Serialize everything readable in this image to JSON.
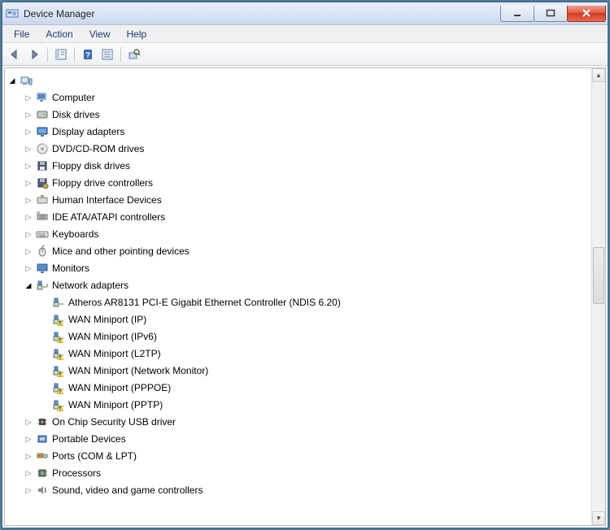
{
  "window": {
    "title": "Device Manager"
  },
  "menu": {
    "file": "File",
    "action": "Action",
    "view": "View",
    "help": "Help"
  },
  "root": {
    "label": ""
  },
  "categories": [
    {
      "label": "Computer",
      "icon": "computer"
    },
    {
      "label": "Disk drives",
      "icon": "disk"
    },
    {
      "label": "Display adapters",
      "icon": "display"
    },
    {
      "label": "DVD/CD-ROM drives",
      "icon": "optical"
    },
    {
      "label": "Floppy disk drives",
      "icon": "floppy"
    },
    {
      "label": "Floppy drive controllers",
      "icon": "floppy-ctrl"
    },
    {
      "label": "Human Interface Devices",
      "icon": "hid"
    },
    {
      "label": "IDE ATA/ATAPI controllers",
      "icon": "ide"
    },
    {
      "label": "Keyboards",
      "icon": "keyboard"
    },
    {
      "label": "Mice and other pointing devices",
      "icon": "mouse"
    },
    {
      "label": "Monitors",
      "icon": "monitor"
    }
  ],
  "network": {
    "label": "Network adapters",
    "children": [
      {
        "label": "Atheros AR8131 PCI-E Gigabit Ethernet Controller (NDIS 6.20)",
        "warn": false
      },
      {
        "label": "WAN Miniport (IP)",
        "warn": true
      },
      {
        "label": "WAN Miniport (IPv6)",
        "warn": true
      },
      {
        "label": "WAN Miniport (L2TP)",
        "warn": true
      },
      {
        "label": "WAN Miniport (Network Monitor)",
        "warn": true
      },
      {
        "label": "WAN Miniport (PPPOE)",
        "warn": true
      },
      {
        "label": "WAN Miniport (PPTP)",
        "warn": true
      }
    ]
  },
  "categories2": [
    {
      "label": "On Chip Security USB driver",
      "icon": "chip"
    },
    {
      "label": "Portable Devices",
      "icon": "portable"
    },
    {
      "label": "Ports (COM & LPT)",
      "icon": "ports"
    },
    {
      "label": "Processors",
      "icon": "cpu"
    },
    {
      "label": "Sound, video and game controllers",
      "icon": "sound"
    }
  ]
}
